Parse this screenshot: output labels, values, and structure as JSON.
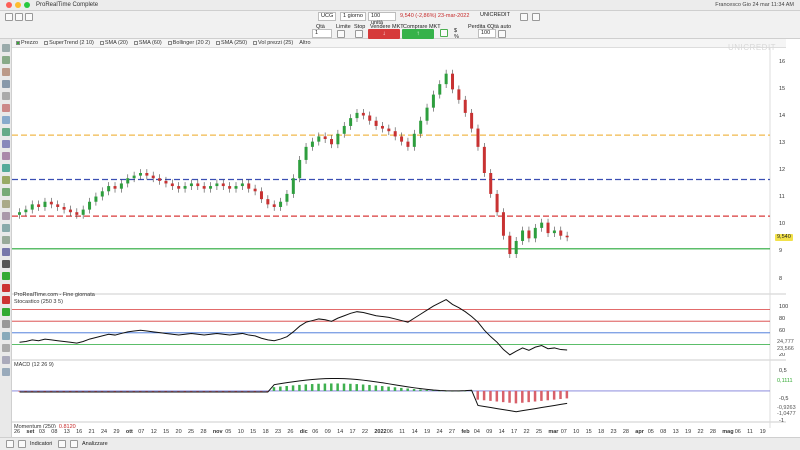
{
  "window": {
    "title": "ProRealTime Complete",
    "status_right": "Francesco     Gio 24 mar  11:34 AM"
  },
  "toolbar": {
    "ticker": "UCG",
    "period": "1 giorno",
    "units": "100 unità",
    "price": "9,540 (-2,86%) 23-mar-2022",
    "name": "UNICREDIT",
    "qty_label": "Qtà",
    "qty_value": "1",
    "limit_label": "Limite",
    "stop_label": "Stop",
    "sell_label": "Vendere MKT",
    "buy_label": "Comprare MKT",
    "loss_label": "Perdita €",
    "auto_label": "Qtà auto",
    "auto_value": "100"
  },
  "chart": {
    "watermark": "UNICREDIT",
    "indicators": [
      "Prezzo",
      "SuperTrend (2 10)",
      "SMA (20)",
      "SMA (60)",
      "Bollinger (20 2)",
      "SMA (250)",
      "Vol prezzi (25)",
      "Altro"
    ],
    "source": "ProRealTime.com - Fine giornata",
    "last_price": "9,540",
    "price_ticks": [
      "16",
      "15",
      "14",
      "13",
      "12",
      "11",
      "10",
      "9",
      "8"
    ],
    "stoch_label": "Stocastico (250 3 5)",
    "stoch_ticks": [
      "100",
      "80",
      "60",
      "40",
      "20"
    ],
    "stoch_values": [
      "24,777",
      "23,566"
    ],
    "macd_label": "MACD (12 26 9)",
    "macd_ticks": [
      "0,5",
      "-0,5",
      "-1"
    ],
    "macd_values": [
      "0,1111",
      "-0,9263",
      "-1,0477"
    ],
    "momentum_label": "Momentum (250)",
    "momentum_value": "0,8120",
    "x_labels": [
      "26",
      "set",
      "03",
      "08",
      "13",
      "16",
      "21",
      "24",
      "29",
      "ott",
      "07",
      "12",
      "15",
      "20",
      "25",
      "28",
      "nov",
      "05",
      "10",
      "15",
      "18",
      "23",
      "26",
      "dic",
      "06",
      "09",
      "14",
      "17",
      "22",
      "2022",
      "06",
      "11",
      "14",
      "19",
      "24",
      "27",
      "feb",
      "04",
      "09",
      "14",
      "17",
      "22",
      "25",
      "mar",
      "07",
      "10",
      "15",
      "18",
      "23",
      "28",
      "apr",
      "05",
      "08",
      "13",
      "19",
      "22",
      "28",
      "mag",
      "06",
      "11",
      "19"
    ],
    "levels": [
      {
        "value": 13.45,
        "color": "#f0b84c"
      },
      {
        "value": 11.75,
        "color": "#3b4fb3"
      },
      {
        "value": 10.35,
        "color": "#d83a3a"
      },
      {
        "value": 9.1,
        "color": "#27a838"
      }
    ]
  },
  "bottombar": {
    "indicators_label": "Indicatori",
    "analyze_label": "Analizzare"
  },
  "chart_data": {
    "type": "candlestick",
    "title": "UNICREDIT",
    "ylim": [
      7.6,
      16.4
    ],
    "closes": [
      10.5,
      10.6,
      10.8,
      10.7,
      10.9,
      10.8,
      10.7,
      10.6,
      10.5,
      10.4,
      10.6,
      10.9,
      11.1,
      11.3,
      11.5,
      11.4,
      11.6,
      11.8,
      11.9,
      12.0,
      11.9,
      11.8,
      11.7,
      11.6,
      11.5,
      11.4,
      11.5,
      11.6,
      11.5,
      11.4,
      11.5,
      11.6,
      11.5,
      11.4,
      11.5,
      11.6,
      11.4,
      11.3,
      11.0,
      10.8,
      10.7,
      10.9,
      11.2,
      11.8,
      12.5,
      13.0,
      13.2,
      13.4,
      13.3,
      13.1,
      13.5,
      13.8,
      14.1,
      14.3,
      14.2,
      14.0,
      13.8,
      13.7,
      13.6,
      13.4,
      13.2,
      13.0,
      13.5,
      14.0,
      14.5,
      15.0,
      15.4,
      15.8,
      15.2,
      14.8,
      14.3,
      13.7,
      13.0,
      12.0,
      11.2,
      10.5,
      9.6,
      8.9,
      9.4,
      9.8,
      9.5,
      9.9,
      10.1,
      9.7,
      9.8,
      9.6,
      9.54
    ]
  }
}
